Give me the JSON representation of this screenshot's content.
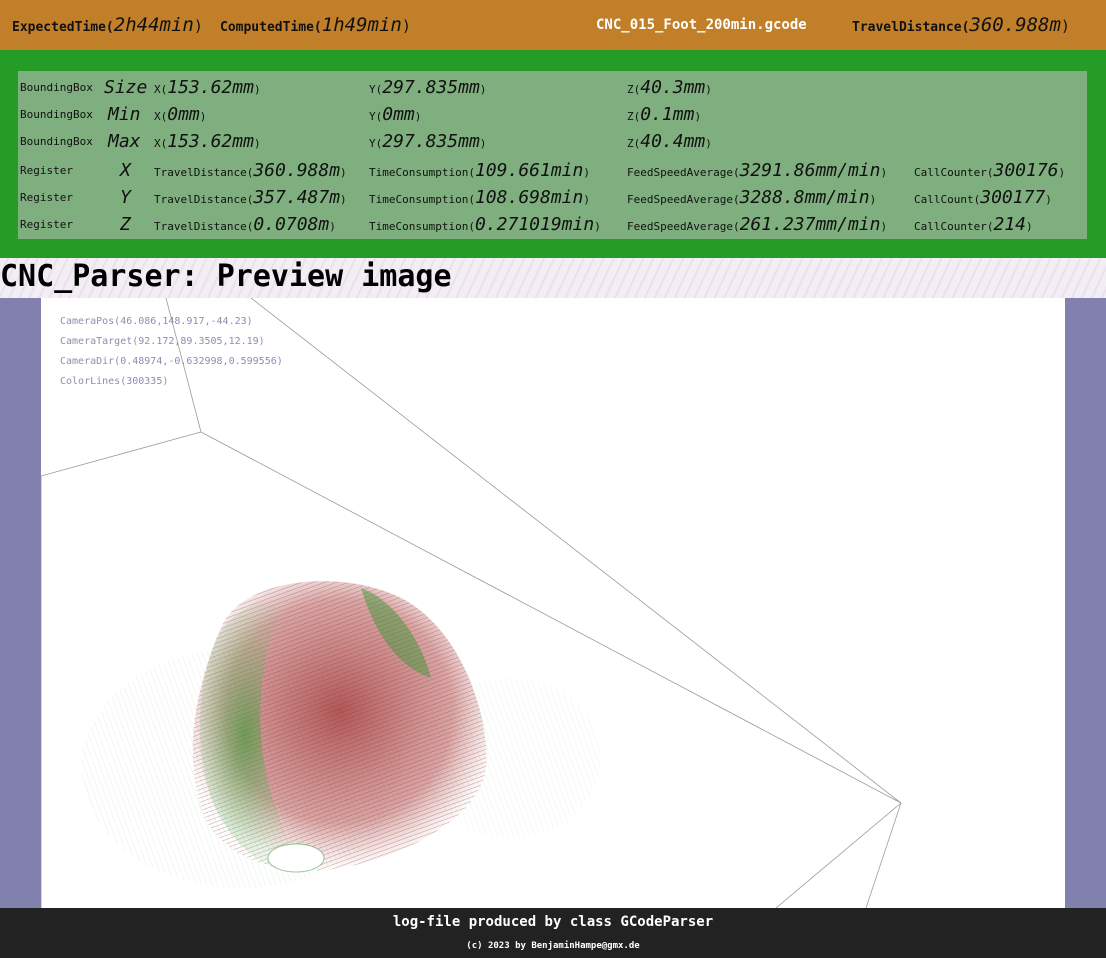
{
  "header": {
    "expected_label": "ExpectedTime(",
    "expected_value": "2h44min",
    "expected_close": ")",
    "computed_label": "ComputedTime(",
    "computed_value": "1h49min",
    "computed_close": ")",
    "filename": "CNC_015_Foot_200min.gcode",
    "travel_label": "TravelDistance(",
    "travel_value": "360.988m",
    "travel_close": ")"
  },
  "stats": {
    "bbox_rows": [
      {
        "label": "BoundingBox",
        "kind": "Size",
        "x_label": "X(",
        "x": "153.62mm",
        "y_label": "Y(",
        "y": "297.835mm",
        "z_label": "Z(",
        "z": "40.3mm"
      },
      {
        "label": "BoundingBox",
        "kind": "Min",
        "x_label": "X(",
        "x": "0mm",
        "y_label": "Y(",
        "y": "0mm",
        "z_label": "Z(",
        "z": "0.1mm"
      },
      {
        "label": "BoundingBox",
        "kind": "Max",
        "x_label": "X(",
        "x": "153.62mm",
        "y_label": "Y(",
        "y": "297.835mm",
        "z_label": "Z(",
        "z": "40.4mm"
      }
    ],
    "register_rows": [
      {
        "label": "Register",
        "axis": "X",
        "dist_label": "TravelDistance(",
        "dist": "360.988m",
        "time_label": "TimeConsumption(",
        "time": "109.661min",
        "feed_label": "FeedSpeedAverage(",
        "feed": "3291.86mm/min",
        "count_label": "CallCounter(",
        "count": "300176"
      },
      {
        "label": "Register",
        "axis": "Y",
        "dist_label": "TravelDistance(",
        "dist": "357.487m",
        "time_label": "TimeConsumption(",
        "time": "108.698min",
        "feed_label": "FeedSpeedAverage(",
        "feed": "3288.8mm/min",
        "count_label": "CallCount(",
        "count": "300177"
      },
      {
        "label": "Register",
        "axis": "Z",
        "dist_label": "TravelDistance(",
        "dist": "0.0708m",
        "time_label": "TimeConsumption(",
        "time": "0.271019min",
        "feed_label": "FeedSpeedAverage(",
        "feed": "261.237mm/min",
        "count_label": "CallCounter(",
        "count": "214"
      }
    ],
    "close_paren": ")"
  },
  "page_title": "CNC_Parser: Preview image",
  "preview": {
    "camera_pos": "CameraPos(46.086,148.917,-44.23)",
    "camera_target": "CameraTarget(92.172,89.3505,12.19)",
    "camera_dir": "CameraDir(0.48974,-0.632998,0.599556)",
    "color_lines": "ColorLines(300335)",
    "colors": {
      "toolpath_red": "#a33b3b",
      "toolpath_green": "#2f9a2f",
      "box_line": "#9a9a9a"
    }
  },
  "footer": {
    "main": "log-file produced by class GCodeParser",
    "copy": "(c) 2023 by BenjaminHampe@gmx.de"
  },
  "colors": {
    "header_bg": "#c17f2a",
    "stats_outer": "#249c25",
    "stats_inner": "#7fae7f",
    "preview_frame": "#8280ac",
    "footer_bg": "#222222"
  }
}
